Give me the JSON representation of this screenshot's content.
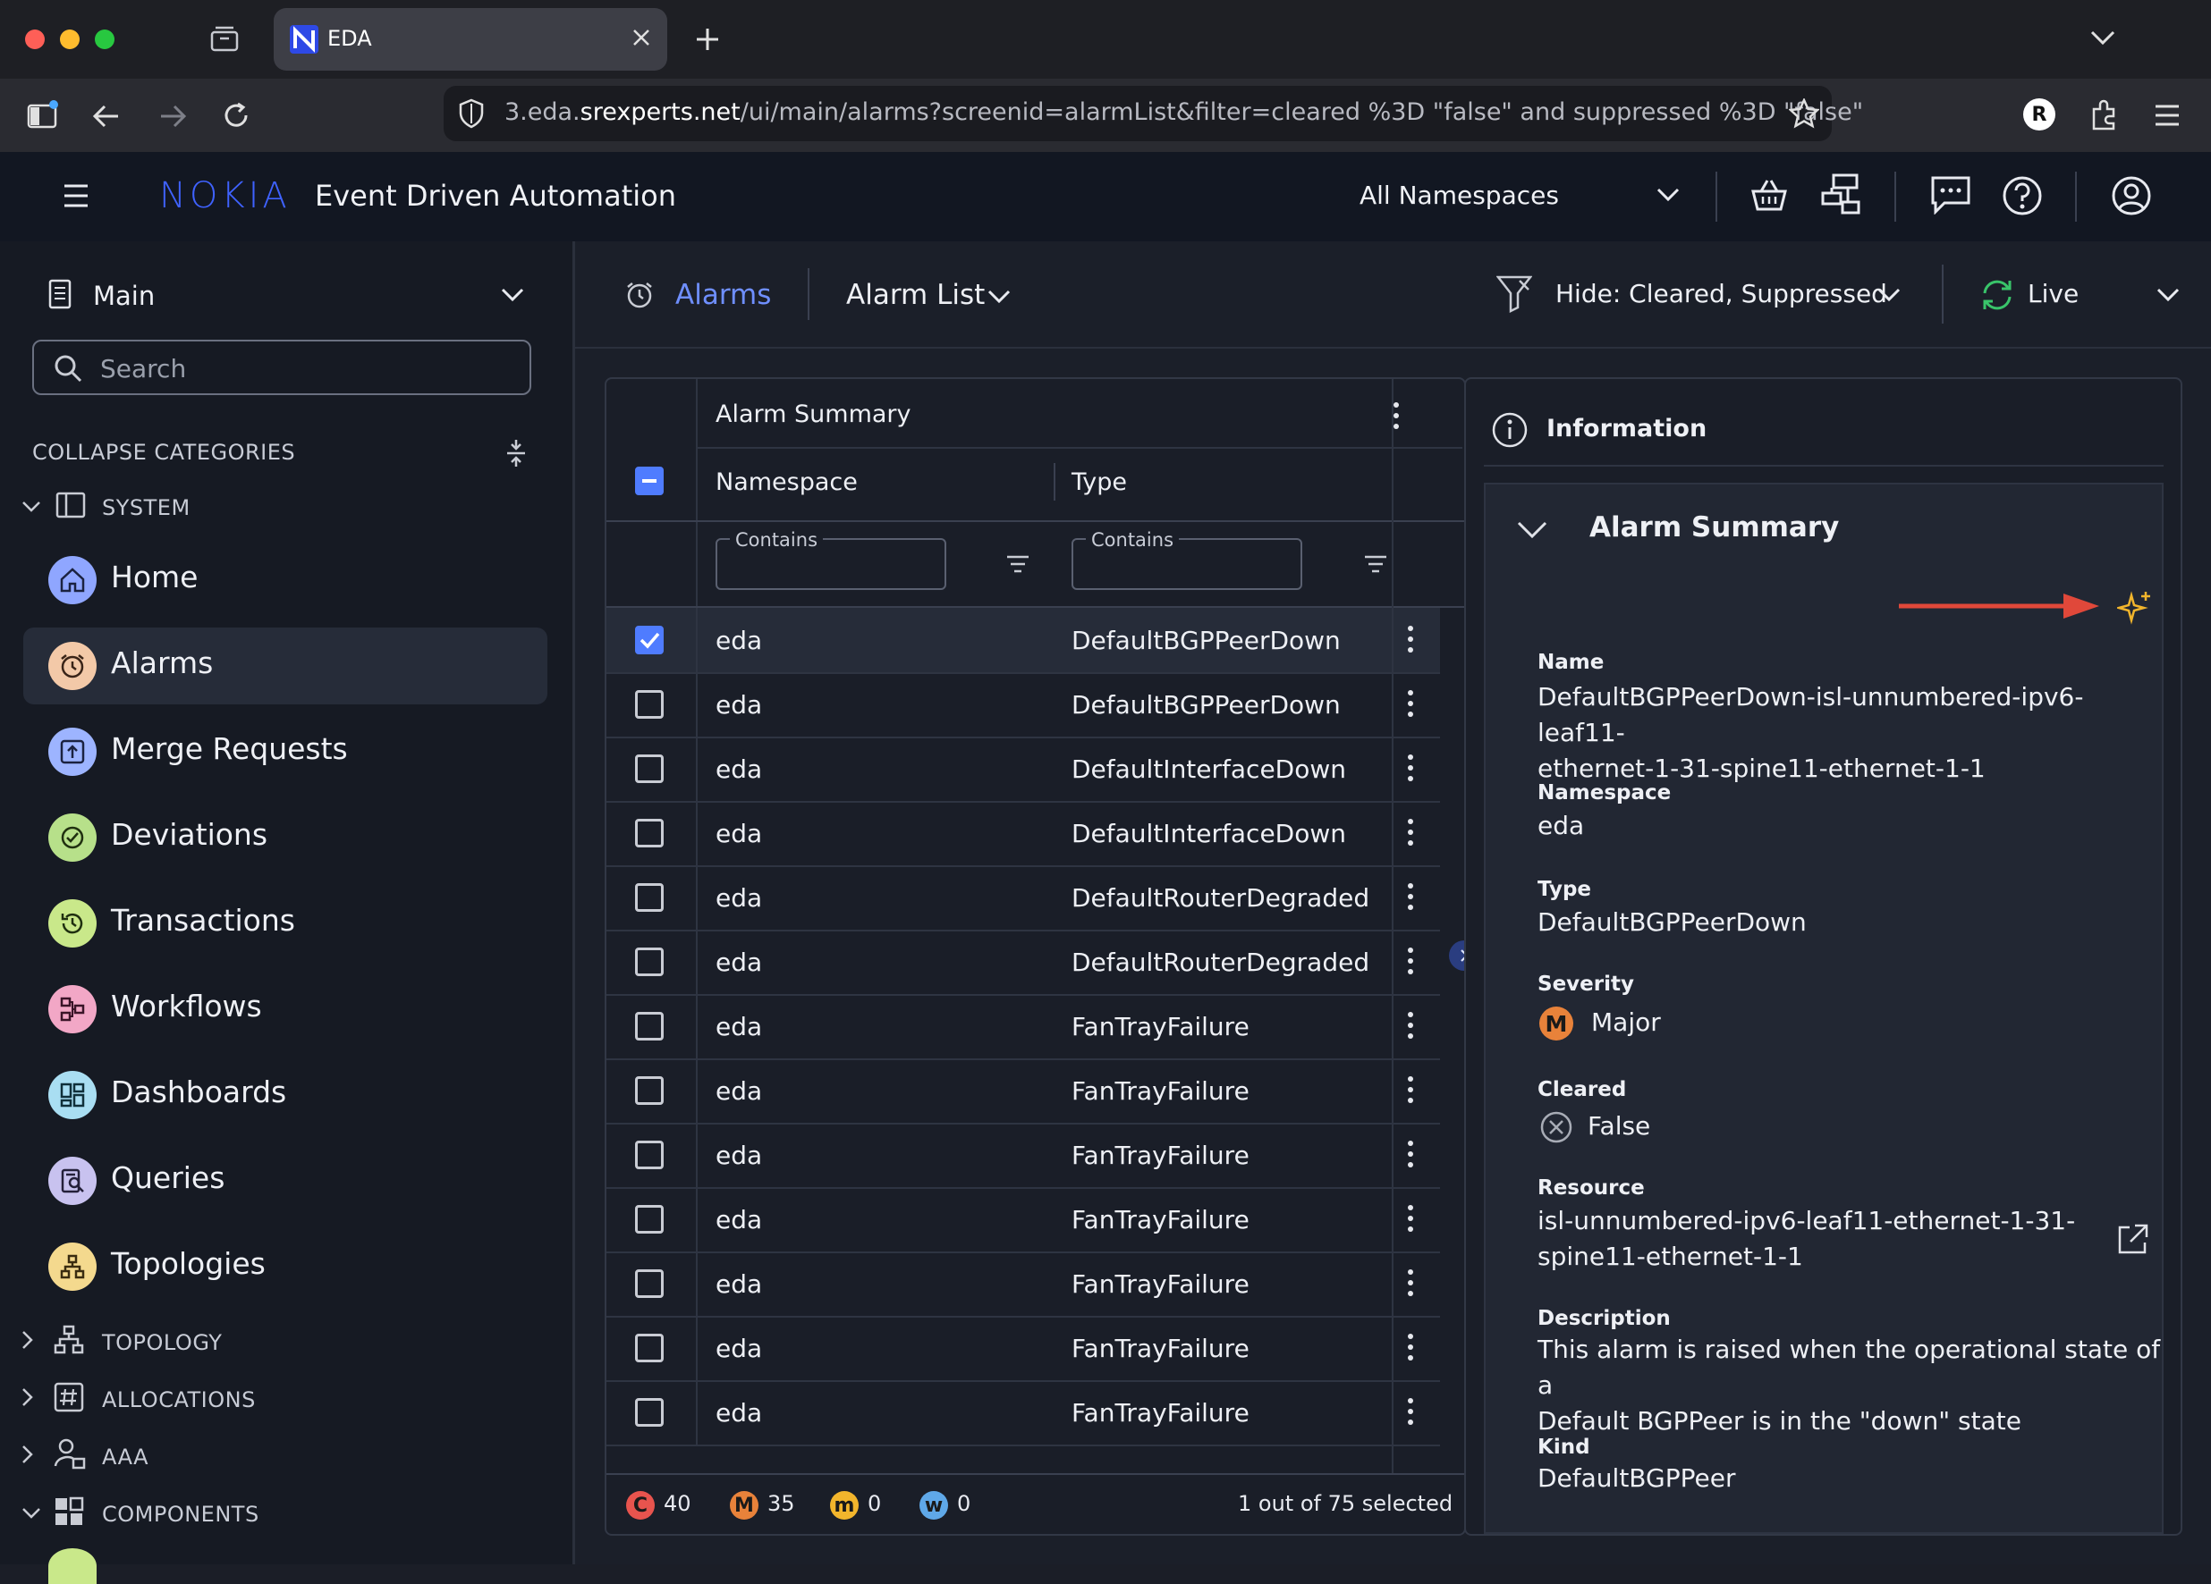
{
  "browser": {
    "tab_title": "EDA",
    "url_prefix": "3.eda.",
    "url_domain": "srexperts.net",
    "url_path": "/ui/main/alarms?screenid=alarmList&filter=cleared %3D \"false\" and suppressed %3D \"false\"",
    "profile_initial": "R"
  },
  "header": {
    "logo": "NOKIA",
    "app_title": "Event Driven Automation",
    "namespace": "All Namespaces"
  },
  "sidebar": {
    "context": "Main",
    "search_placeholder": "Search",
    "collapse_label": "COLLAPSE CATEGORIES",
    "system_label": "SYSTEM",
    "items": [
      {
        "label": "Home",
        "color": "#8fa6ff"
      },
      {
        "label": "Alarms",
        "color": "#f3c9a8"
      },
      {
        "label": "Merge Requests",
        "color": "#9db4ff"
      },
      {
        "label": "Deviations",
        "color": "#b7e08a"
      },
      {
        "label": "Transactions",
        "color": "#c9e88a"
      },
      {
        "label": "Workflows",
        "color": "#f2a7c6"
      },
      {
        "label": "Dashboards",
        "color": "#a9def2"
      },
      {
        "label": "Queries",
        "color": "#c8c2ef"
      },
      {
        "label": "Topologies",
        "color": "#f4d98e"
      }
    ],
    "categories": [
      "TOPOLOGY",
      "ALLOCATIONS",
      "AAA",
      "COMPONENTS"
    ]
  },
  "toolbar": {
    "section": "Alarms",
    "view": "Alarm List",
    "filter": "Hide: Cleared, Suppressed",
    "mode": "Live"
  },
  "table": {
    "group_header": "Alarm Summary",
    "col_namespace": "Namespace",
    "col_type": "Type",
    "filter_placeholder": "Contains",
    "rows": [
      {
        "namespace": "eda",
        "type": "DefaultBGPPeerDown",
        "checked": true
      },
      {
        "namespace": "eda",
        "type": "DefaultBGPPeerDown",
        "checked": false
      },
      {
        "namespace": "eda",
        "type": "DefaultInterfaceDown",
        "checked": false
      },
      {
        "namespace": "eda",
        "type": "DefaultInterfaceDown",
        "checked": false
      },
      {
        "namespace": "eda",
        "type": "DefaultRouterDegraded",
        "checked": false
      },
      {
        "namespace": "eda",
        "type": "DefaultRouterDegraded",
        "checked": false
      },
      {
        "namespace": "eda",
        "type": "FanTrayFailure",
        "checked": false
      },
      {
        "namespace": "eda",
        "type": "FanTrayFailure",
        "checked": false
      },
      {
        "namespace": "eda",
        "type": "FanTrayFailure",
        "checked": false
      },
      {
        "namespace": "eda",
        "type": "FanTrayFailure",
        "checked": false
      },
      {
        "namespace": "eda",
        "type": "FanTrayFailure",
        "checked": false
      },
      {
        "namespace": "eda",
        "type": "FanTrayFailure",
        "checked": false
      },
      {
        "namespace": "eda",
        "type": "FanTrayFailure",
        "checked": false
      }
    ],
    "footer": {
      "critical": {
        "letter": "C",
        "count": "40",
        "color": "#e8544e"
      },
      "major": {
        "letter": "M",
        "count": "35",
        "color": "#e8823a"
      },
      "minor": {
        "letter": "m",
        "count": "0",
        "color": "#f2b52c"
      },
      "warning": {
        "letter": "w",
        "count": "0",
        "color": "#5fa8e8"
      },
      "selected": "1 out of 75 selected"
    }
  },
  "info": {
    "title": "Information",
    "section": "Alarm Summary",
    "name_label": "Name",
    "name_line1": "DefaultBGPPeerDown-isl-unnumbered-ipv6-leaf11-",
    "name_line2": "ethernet-1-31-spine11-ethernet-1-1",
    "namespace_label": "Namespace",
    "namespace": "eda",
    "type_label": "Type",
    "type": "DefaultBGPPeerDown",
    "severity_label": "Severity",
    "severity_letter": "M",
    "severity": "Major",
    "cleared_label": "Cleared",
    "cleared": "False",
    "resource_label": "Resource",
    "resource_line1": "isl-unnumbered-ipv6-leaf11-ethernet-1-31-",
    "resource_line2": "spine11-ethernet-1-1",
    "description_label": "Description",
    "description_line1": "This alarm is raised when the operational state of a",
    "description_line2": "Default BGPPeer is in the \"down\" state",
    "kind_label": "Kind",
    "kind": "DefaultBGPPeer"
  }
}
